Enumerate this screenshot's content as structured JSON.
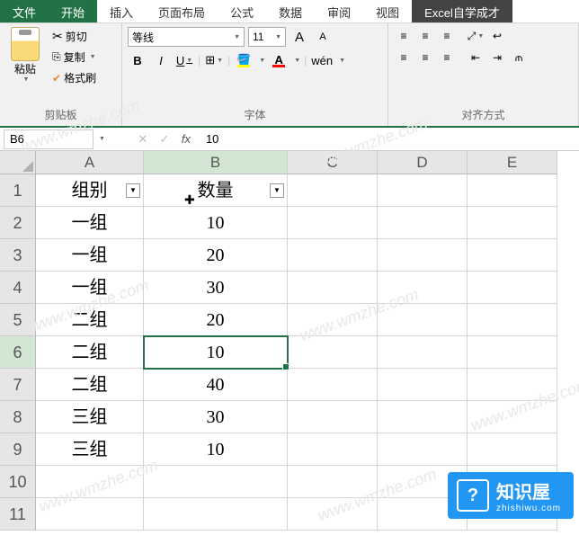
{
  "tabs": {
    "file": "文件",
    "home": "开始",
    "insert": "插入",
    "layout": "页面布局",
    "formula": "公式",
    "data": "数据",
    "review": "审阅",
    "view": "视图",
    "addin": "Excel自学成才"
  },
  "ribbon": {
    "clipboard": {
      "paste": "粘贴",
      "cut": "剪切",
      "copy": "复制",
      "painter": "格式刷",
      "label": "剪贴板"
    },
    "font": {
      "name": "等线",
      "size": "11",
      "bold": "B",
      "italic": "I",
      "underline": "U",
      "ruby": "wén",
      "label": "字体",
      "grow": "A",
      "shrink": "A"
    },
    "align": {
      "label": "对齐方式"
    }
  },
  "fbar": {
    "namebox": "B6",
    "fx": "fx",
    "value": "10"
  },
  "cols": [
    "A",
    "B",
    "C",
    "D",
    "E"
  ],
  "rows": [
    "1",
    "2",
    "3",
    "4",
    "5",
    "6",
    "7",
    "8",
    "9",
    "10",
    "11"
  ],
  "data": {
    "A1": "组别",
    "B1": "数量",
    "A2": "一组",
    "B2": "10",
    "A3": "一组",
    "B3": "20",
    "A4": "一组",
    "B4": "30",
    "A5": "二组",
    "B5": "20",
    "A6": "二组",
    "B6": "10",
    "A7": "二组",
    "B7": "40",
    "A8": "三组",
    "B8": "30",
    "A9": "三组",
    "B9": "10"
  },
  "watermark": "www.wmzhe.com",
  "banner": {
    "title": "知识屋",
    "sub": "zhishiwu.com",
    "icon": "?"
  }
}
